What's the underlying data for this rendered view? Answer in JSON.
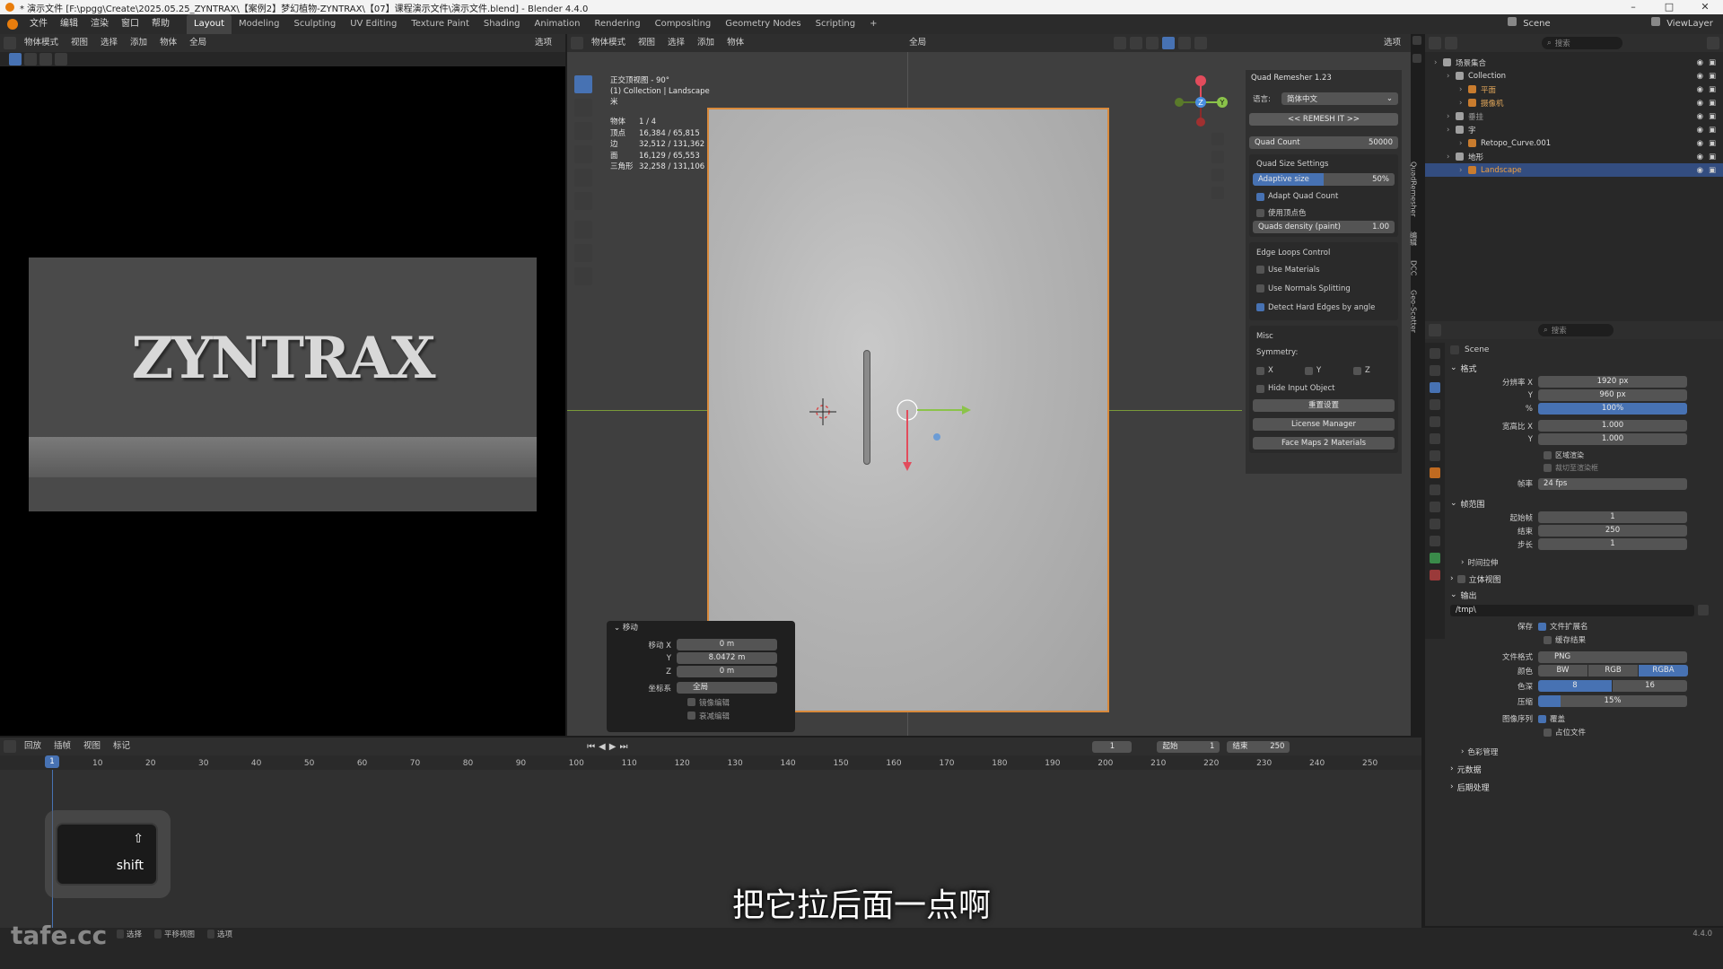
{
  "titlebar": {
    "title": "* 演示文件 [F:\\ppgg\\Create\\2025.05.25_ZYNTRAX\\【案例2】梦幻植物-ZYNTRAX\\【07】课程演示文件\\演示文件.blend] - Blender 4.4.0",
    "minimize": "–",
    "maximize": "□",
    "close": "✕"
  },
  "menu": {
    "items": [
      "文件",
      "编辑",
      "渲染",
      "窗口",
      "帮助"
    ],
    "workspaces": [
      "Layout",
      "Modeling",
      "Sculpting",
      "UV Editing",
      "Texture Paint",
      "Shading",
      "Animation",
      "Rendering",
      "Compositing",
      "Geometry Nodes",
      "Scripting",
      "+"
    ],
    "scene_label": "Scene",
    "viewlayer_label": "ViewLayer"
  },
  "left_viewport": {
    "mode": "物体模式",
    "menus": [
      "视图",
      "选择",
      "添加",
      "物体"
    ],
    "transform": "全局",
    "options": "选项",
    "logo_text": "ZYNTRAX"
  },
  "main_viewport": {
    "mode": "物体模式",
    "menus": [
      "视图",
      "选择",
      "添加",
      "物体"
    ],
    "transform": "全局",
    "options": "选项",
    "view_name": "正交顶视图 - 90°",
    "collection_info": "(1) Collection | Landscape",
    "unit": "米",
    "stats": [
      {
        "label": "物体",
        "value": "1 / 4"
      },
      {
        "label": "顶点",
        "value": "16,384 / 65,815"
      },
      {
        "label": "边",
        "value": "32,512 / 131,362"
      },
      {
        "label": "面",
        "value": "16,129 / 65,553"
      },
      {
        "label": "三角形",
        "value": "32,258 / 131,106"
      }
    ],
    "gizmo_axes": {
      "x": "X",
      "y": "Y",
      "z": "Z"
    }
  },
  "move_panel": {
    "title": "移动",
    "move_x_label": "移动 X",
    "move_x": "0 m",
    "y_label": "Y",
    "move_y": "8.0472 m",
    "z_label": "Z",
    "move_z": "0 m",
    "coord_label": "坐标系",
    "coord_value": "全局",
    "opt1": "镜像编辑",
    "opt2": "衰减编辑"
  },
  "npanel": {
    "title": "Quad Remesher 1.23",
    "lang_label": "语言:",
    "lang_value": "简体中文",
    "remesh_button": "<< REMESH IT >>",
    "quad_count_label": "Quad Count",
    "quad_count": "50000",
    "quad_size_settings": "Quad Size Settings",
    "adaptive_size_label": "Adaptive size",
    "adaptive_size": "50%",
    "adapt_quad_count": "Adapt Quad Count",
    "use_vertex_color": "使用顶点色",
    "quads_density_label": "Quads density (paint)",
    "quads_density": "1.00",
    "edge_loops": "Edge Loops Control",
    "use_materials": "Use Materials",
    "use_normals": "Use Normals Splitting",
    "detect_hard": "Detect Hard Edges by angle",
    "misc": "Misc",
    "symmetry": "Symmetry:",
    "sym_x": "X",
    "sym_y": "Y",
    "sym_z": "Z",
    "hide_input": "Hide Input Object",
    "reset": "重置设置",
    "license": "License Manager",
    "facemaps": "Face Maps 2 Materials",
    "side_tabs": [
      "QuadRemesher",
      "编辑",
      "DCC",
      "Geo-Scatter"
    ]
  },
  "outliner": {
    "search_placeholder": "搜索",
    "rows": [
      {
        "label": "场景集合",
        "indent": 0,
        "selected": false,
        "color": "#cfcfcf"
      },
      {
        "label": "Collection",
        "indent": 1,
        "selected": false,
        "color": "#dcdcdc"
      },
      {
        "label": "平面",
        "indent": 2,
        "selected": false,
        "color": "#e2a75a"
      },
      {
        "label": "摄像机",
        "indent": 2,
        "selected": false,
        "color": "#e2a75a"
      },
      {
        "label": "垂挂",
        "indent": 1,
        "selected": false,
        "color": "#9a9a9a"
      },
      {
        "label": "字",
        "indent": 1,
        "selected": false,
        "color": "#dcdcdc"
      },
      {
        "label": "Retopo_Curve.001",
        "indent": 2,
        "selected": false,
        "color": "#dcdcdc"
      },
      {
        "label": "地形",
        "indent": 1,
        "selected": false,
        "color": "#dcdcdc"
      },
      {
        "label": "Landscape",
        "indent": 2,
        "selected": true,
        "color": "#f0a040"
      }
    ]
  },
  "properties": {
    "search_placeholder": "搜索",
    "scene_name": "Scene",
    "format_section": "格式",
    "res_x_label": "分辨率 X",
    "res_x": "1920 px",
    "res_y_label": "Y",
    "res_y": "960 px",
    "res_pct_label": "%",
    "res_pct": "100%",
    "aspect_x_label": "宽高比 X",
    "aspect_x": "1.000",
    "aspect_y_label": "Y",
    "aspect_y": "1.000",
    "border_render": "区域渲染",
    "crop": "裁切至渲染框",
    "fps_label": "帧率",
    "fps": "24 fps",
    "frame_range_section": "帧范围",
    "start_label": "起始帧",
    "start": "1",
    "end_label": "结束",
    "end": "250",
    "step_label": "步长",
    "step": "1",
    "time_stretch": "时间拉伸",
    "stereo": "立体视图",
    "output_section": "输出",
    "output_path": "/tmp\\",
    "save_label": "保存",
    "file_ext": "文件扩展名",
    "cache_result": "缓存结果",
    "file_format_label": "文件格式",
    "file_format": "PNG",
    "color_label": "颜色",
    "color_bw": "BW",
    "color_rgb": "RGB",
    "color_rgba": "RGBA",
    "depth_label": "色深",
    "depth_8": "8",
    "depth_16": "16",
    "compress_label": "压缩",
    "compress": "15%",
    "image_seq_label": "图像序列",
    "overwrite": "覆盖",
    "placeholders": "占位文件",
    "color_mgmt": "色彩管理",
    "metadata": "元数据",
    "post": "后期处理"
  },
  "timeline": {
    "menus": [
      "回放",
      "插帧",
      "视图",
      "标记"
    ],
    "current_frame": "1",
    "start_label": "起始",
    "start": "1",
    "end_label": "结束",
    "end": "250",
    "ticks": [
      "1",
      "10",
      "20",
      "30",
      "40",
      "50",
      "60",
      "70",
      "80",
      "90",
      "100",
      "110",
      "120",
      "130",
      "140",
      "150",
      "160",
      "170",
      "180",
      "190",
      "200",
      "210",
      "220",
      "230",
      "240",
      "250"
    ]
  },
  "status": {
    "items": [
      "选择",
      "平移视图",
      "选项"
    ],
    "version": "4.4.0",
    "watermark": "tafe.cc"
  },
  "overlay": {
    "subtitle": "把它拉后面一点啊",
    "shift_label": "shift",
    "shift_symbol": "⇧"
  },
  "colors": {
    "accent": "#4772b3",
    "selection_outline": "#d98a3c",
    "axis_x": "#e24c5c",
    "axis_y": "#8bc34a",
    "axis_z": "#4a8fe0"
  }
}
